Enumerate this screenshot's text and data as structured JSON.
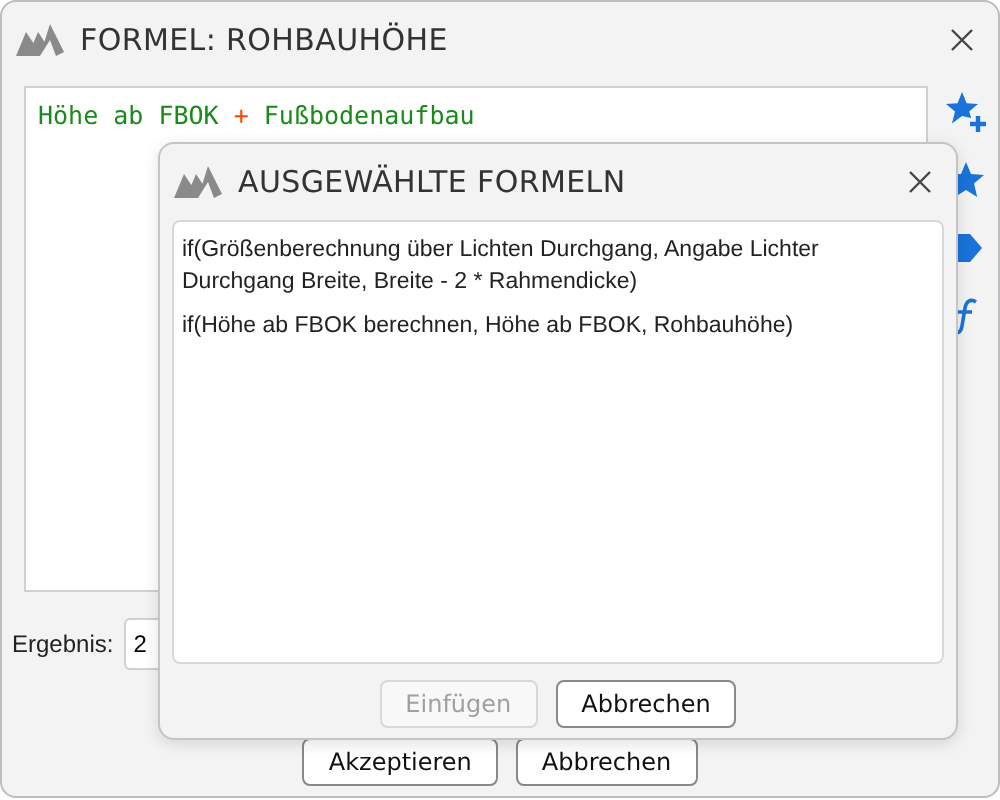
{
  "window": {
    "title": "FORMEL: ROHBAUHÖHE"
  },
  "formula": [
    {
      "kind": "name",
      "text": "Höhe ab FBOK"
    },
    {
      "kind": "operator",
      "text": "+"
    },
    {
      "kind": "name",
      "text": "Fußbodenaufbau"
    }
  ],
  "result": {
    "label": "Ergebnis:",
    "value": "2"
  },
  "buttons": [
    {
      "label": "Akzeptieren"
    },
    {
      "label": "Abbrechen"
    }
  ],
  "dialog": {
    "title": "AUSGEWÄHLTE FORMELN",
    "items": [
      "if(Größenberechnung über Lichten Durchgang, Angabe Lichter Durchgang Breite, Breite - 2 * Rahmendicke)",
      "if(Höhe ab FBOK berechnen, Höhe ab FBOK, Rohbauhöhe)"
    ],
    "buttons": [
      {
        "label": "Einfügen",
        "disabled": true
      },
      {
        "label": "Abbrechen",
        "disabled": false
      }
    ]
  }
}
